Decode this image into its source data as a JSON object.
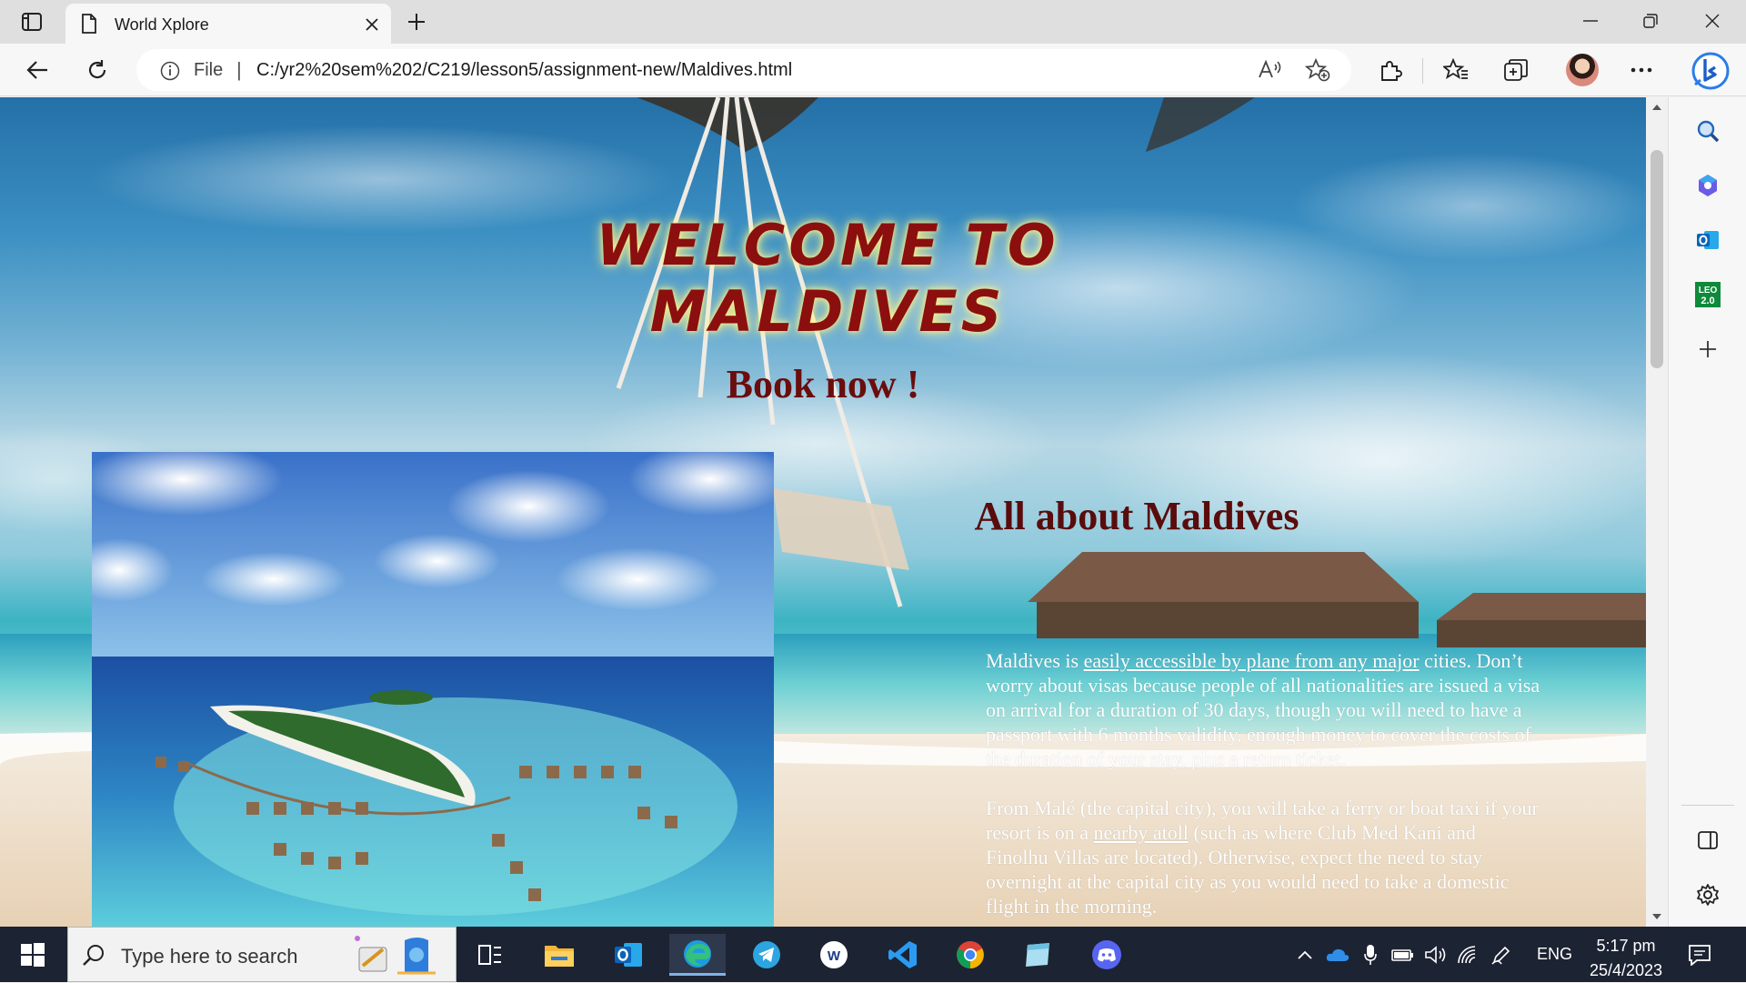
{
  "browser": {
    "tab_title": "World Xplore",
    "address_scheme": "File",
    "address_separator": "|",
    "url": "C:/yr2%20sem%202/C219/lesson5/assignment-new/Maldives.html"
  },
  "page": {
    "title": "WELCOME TO MALDIVES",
    "book_now": "Book now !",
    "about_heading": "All about Maldives",
    "paragraph1_part1": "Maldives is ",
    "paragraph1_part2": "easily accessible by plane from any major",
    "paragraph1_part3": " cities. Don’t worry about visas because people of all nationalities are issued a visa on arrival for a duration of 30 days, though you will need to have a passport with 6 months validity, enough money to cover the costs of the duration of your stay, plus a return ticket.",
    "paragraph2_part1": "From Malé (the capital city), you will take a ferry or boat taxi if your resort is on a ",
    "paragraph2_part2": "nearby atoll",
    "paragraph2_part3": " (such as where Club Med Kani and Finolhu Villas are located). Otherwise, expect the need to stay overnight at the capital city as you would need to take a domestic flight in the morning."
  },
  "taskbar": {
    "search_placeholder": "Type here to search",
    "language": "ENG",
    "time": "5:17 pm",
    "date": "25/4/2023"
  },
  "icons": {
    "tab_actions": "tab-actions-icon",
    "favicon": "page-icon",
    "back": "back-arrow-icon",
    "refresh": "refresh-icon",
    "info": "info-icon",
    "read_aloud": "read-aloud-icon",
    "add_favorite": "add-favorite-icon",
    "extensions": "puzzle-icon",
    "favorites": "favorites-icon",
    "collections": "collections-icon",
    "more": "more-icon",
    "copilot": "bing-icon",
    "sidebar": [
      "search-icon",
      "copilot-icon",
      "outlook-icon",
      "leo-icon",
      "add-icon"
    ],
    "taskbar_apps": [
      "task-view-icon",
      "file-explorer-icon",
      "outlook-icon",
      "edge-icon",
      "telegram-icon",
      "word-app-icon",
      "vscode-icon",
      "chrome-icon",
      "notes-icon",
      "discord-icon"
    ]
  },
  "colors": {
    "title_red": "#8b0f0f",
    "heading_maroon": "#5a0c0c",
    "taskbar_bg": "#1c2333"
  }
}
